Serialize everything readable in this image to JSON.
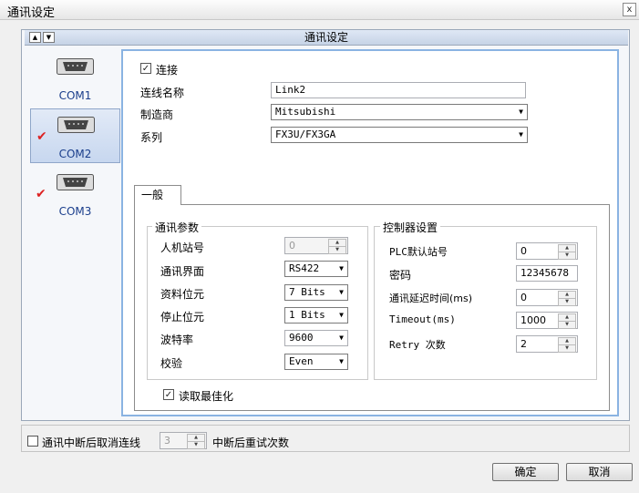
{
  "window": {
    "title": "通讯设定",
    "close_symbol": "x"
  },
  "panel": {
    "header": "通讯设定"
  },
  "com_list": [
    {
      "label": "COM1",
      "checked": false
    },
    {
      "label": "COM2",
      "checked": true,
      "selected": true
    },
    {
      "label": "COM3",
      "checked": true
    }
  ],
  "connection": {
    "connect_label": "连接",
    "connect_checked": true,
    "name_label": "连线名称",
    "name_value": "Link2",
    "vendor_label": "制造商",
    "vendor_value": "Mitsubishi",
    "series_label": "系列",
    "series_value": "FX3U/FX3GA"
  },
  "tab": {
    "label": "一般"
  },
  "comm_params": {
    "title": "通讯参数",
    "station_label": "人机站号",
    "station_value": "0",
    "interface_label": "通讯界面",
    "interface_value": "RS422",
    "databits_label": "资料位元",
    "databits_value": "7 Bits",
    "stopbits_label": "停止位元",
    "stopbits_value": "1 Bits",
    "baud_label": "波特率",
    "baud_value": "9600",
    "parity_label": "校验",
    "parity_value": "Even"
  },
  "controller": {
    "title": "控制器设置",
    "plc_station_label": "PLC默认站号",
    "plc_station_value": "0",
    "password_label": "密码",
    "password_value": "12345678",
    "delay_label": "通讯延迟时间(ms)",
    "delay_value": "0",
    "timeout_label": "Timeout(ms)",
    "timeout_value": "1000",
    "retry_label": "Retry 次数",
    "retry_value": "2"
  },
  "optimize": {
    "label": "读取最佳化",
    "checked": true
  },
  "bottom": {
    "cancel_on_break_label": "通讯中断后取消连线",
    "retry_value": "3",
    "retry_label": "中断后重试次数"
  },
  "buttons": {
    "ok": "确定",
    "cancel": "取消"
  },
  "colors": {
    "accent_border": "#8ab3e2",
    "check_mark": "#d22222",
    "com_label": "#1a3e8c"
  }
}
